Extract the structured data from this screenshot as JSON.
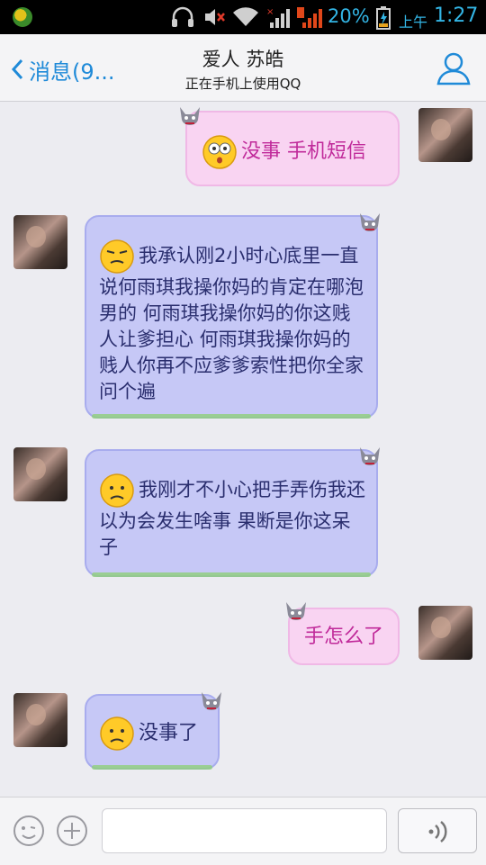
{
  "status_bar": {
    "battery": "20%",
    "ampm": "上午",
    "time": "1:27"
  },
  "header": {
    "back_label": "消息(9...",
    "title": "爱人 苏皓",
    "subtitle": "正在手机上使用QQ"
  },
  "messages": [
    {
      "side": "right",
      "style": "pink",
      "emoji": "dizzy-face",
      "text": "没事  手机短信"
    },
    {
      "side": "left",
      "style": "blue",
      "emoji": "annoyed-face",
      "text": "我承认刚2小时心底里一直说何雨琪我操你妈的肯定在哪泡男的 何雨琪我操你妈的你这贱人让爹担心 何雨琪我操你妈的贱人你再不应爹爹索性把你全家问个遍"
    },
    {
      "side": "left",
      "style": "blue",
      "emoji": "sad-face",
      "text": "我刚才不小心把手弄伤我还以为会发生啥事 果断是你这呆子"
    },
    {
      "side": "right",
      "style": "pink",
      "emoji": "",
      "text": "手怎么了"
    },
    {
      "side": "left",
      "style": "blue",
      "emoji": "sad-face",
      "text": "没事了"
    }
  ],
  "colors": {
    "accent": "#1f8ad8",
    "pink_bubble": "#f9d4f2",
    "blue_bubble": "#c6c8f6"
  }
}
